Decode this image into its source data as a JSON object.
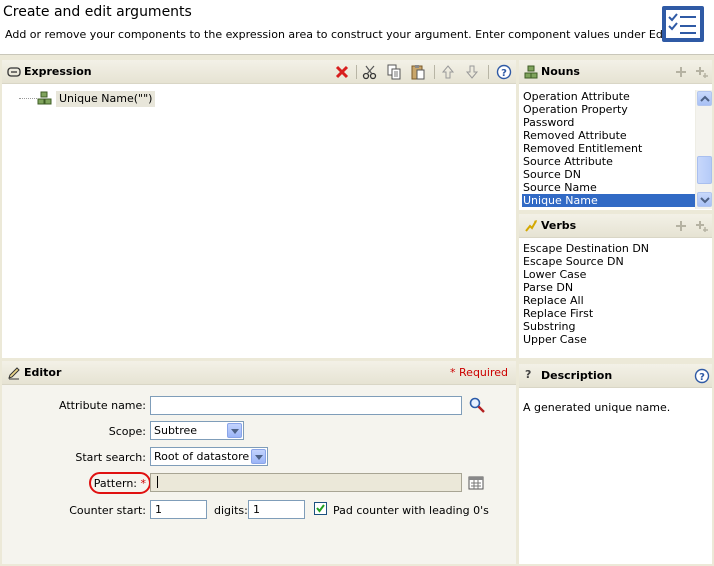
{
  "header": {
    "title": "Create and edit arguments",
    "subtitle": "Add or remove your components to the expression area to construct your argument. Enter component values under Editor."
  },
  "expression": {
    "title": "Expression",
    "tree_node": "Unique Name(\"\")",
    "toolbar_icons": [
      "delete-icon",
      "cut-icon",
      "copy-icon",
      "paste-icon",
      "move-up-icon",
      "move-down-icon",
      "help-icon"
    ]
  },
  "editor": {
    "title": "Editor",
    "required_label": "* Required",
    "attribute_name_label": "Attribute name:",
    "attribute_name_value": "",
    "scope_label": "Scope:",
    "scope_value": "Subtree",
    "start_search_label": "Start search:",
    "start_search_value": "Root of datastore",
    "pattern_label": "Pattern:",
    "pattern_required_mark": "*",
    "pattern_value": "",
    "counter_start_label": "Counter start:",
    "counter_start_value": "1",
    "digits_label": "digits:",
    "digits_value": "1",
    "pad_label": "Pad counter with leading 0's",
    "pad_checked": true
  },
  "nouns": {
    "title": "Nouns",
    "items": [
      "Operation Attribute",
      "Operation Property",
      "Password",
      "Removed Attribute",
      "Removed Entitlement",
      "Source Attribute",
      "Source DN",
      "Source Name",
      "Unique Name"
    ],
    "selected": "Unique Name"
  },
  "verbs": {
    "title": "Verbs",
    "items": [
      "Escape Destination DN",
      "Escape Source DN",
      "Lower Case",
      "Parse DN",
      "Replace All",
      "Replace First",
      "Substring",
      "Upper Case"
    ]
  },
  "description": {
    "title": "Description",
    "text": "A generated unique name."
  },
  "colors": {
    "selection": "#316ac5",
    "required": "#cc0000",
    "highlight_ring": "#e01010"
  }
}
